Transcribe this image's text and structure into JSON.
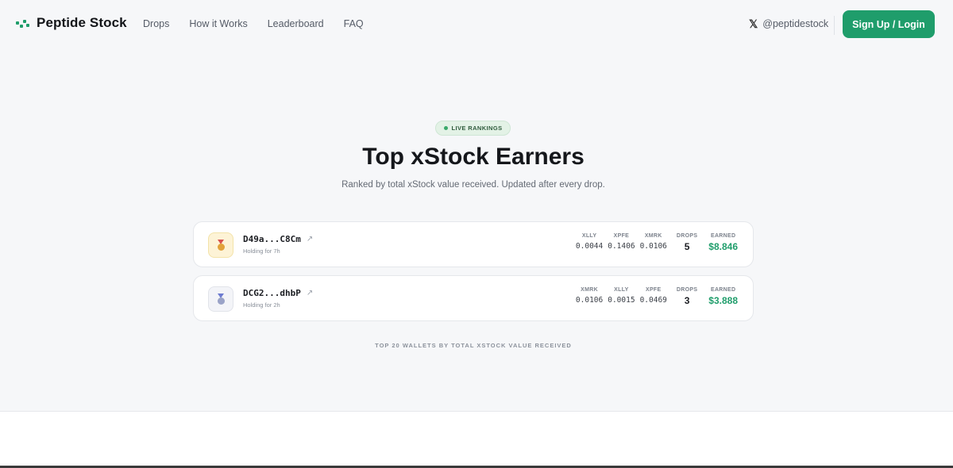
{
  "header": {
    "logo_text": "Peptide Stock",
    "nav": [
      "Drops",
      "How it Works",
      "Leaderboard",
      "FAQ"
    ],
    "social_handle": "@peptidestock",
    "signup_label": "Sign Up / Login",
    "accent_color": "#1f9d6b"
  },
  "hero": {
    "badge": "LIVE RANKINGS",
    "title": "Top xStock Earners",
    "subtitle": "Ranked by total xStock value received. Updated after every drop."
  },
  "leaderboard": {
    "rows": [
      {
        "medal": "gold-medal-icon",
        "wallet": "D49a...C8Cm",
        "holding": "Holding for 7h",
        "tokens": [
          {
            "label": "XLLY",
            "value": "0.0044"
          },
          {
            "label": "XPFE",
            "value": "0.1406"
          },
          {
            "label": "XMRK",
            "value": "0.0106"
          }
        ],
        "drops_label": "DROPS",
        "drops": "5",
        "earned_label": "EARNED",
        "earned": "$8.846"
      },
      {
        "medal": "silver-medal-icon",
        "wallet": "DCG2...dhbP",
        "holding": "Holding for 2h",
        "tokens": [
          {
            "label": "XMRK",
            "value": "0.0106"
          },
          {
            "label": "XLLY",
            "value": "0.0015"
          },
          {
            "label": "XPFE",
            "value": "0.0469"
          }
        ],
        "drops_label": "DROPS",
        "drops": "3",
        "earned_label": "EARNED",
        "earned": "$3.888"
      }
    ],
    "footnote": "TOP 20 WALLETS BY TOTAL XSTOCK VALUE RECEIVED"
  }
}
